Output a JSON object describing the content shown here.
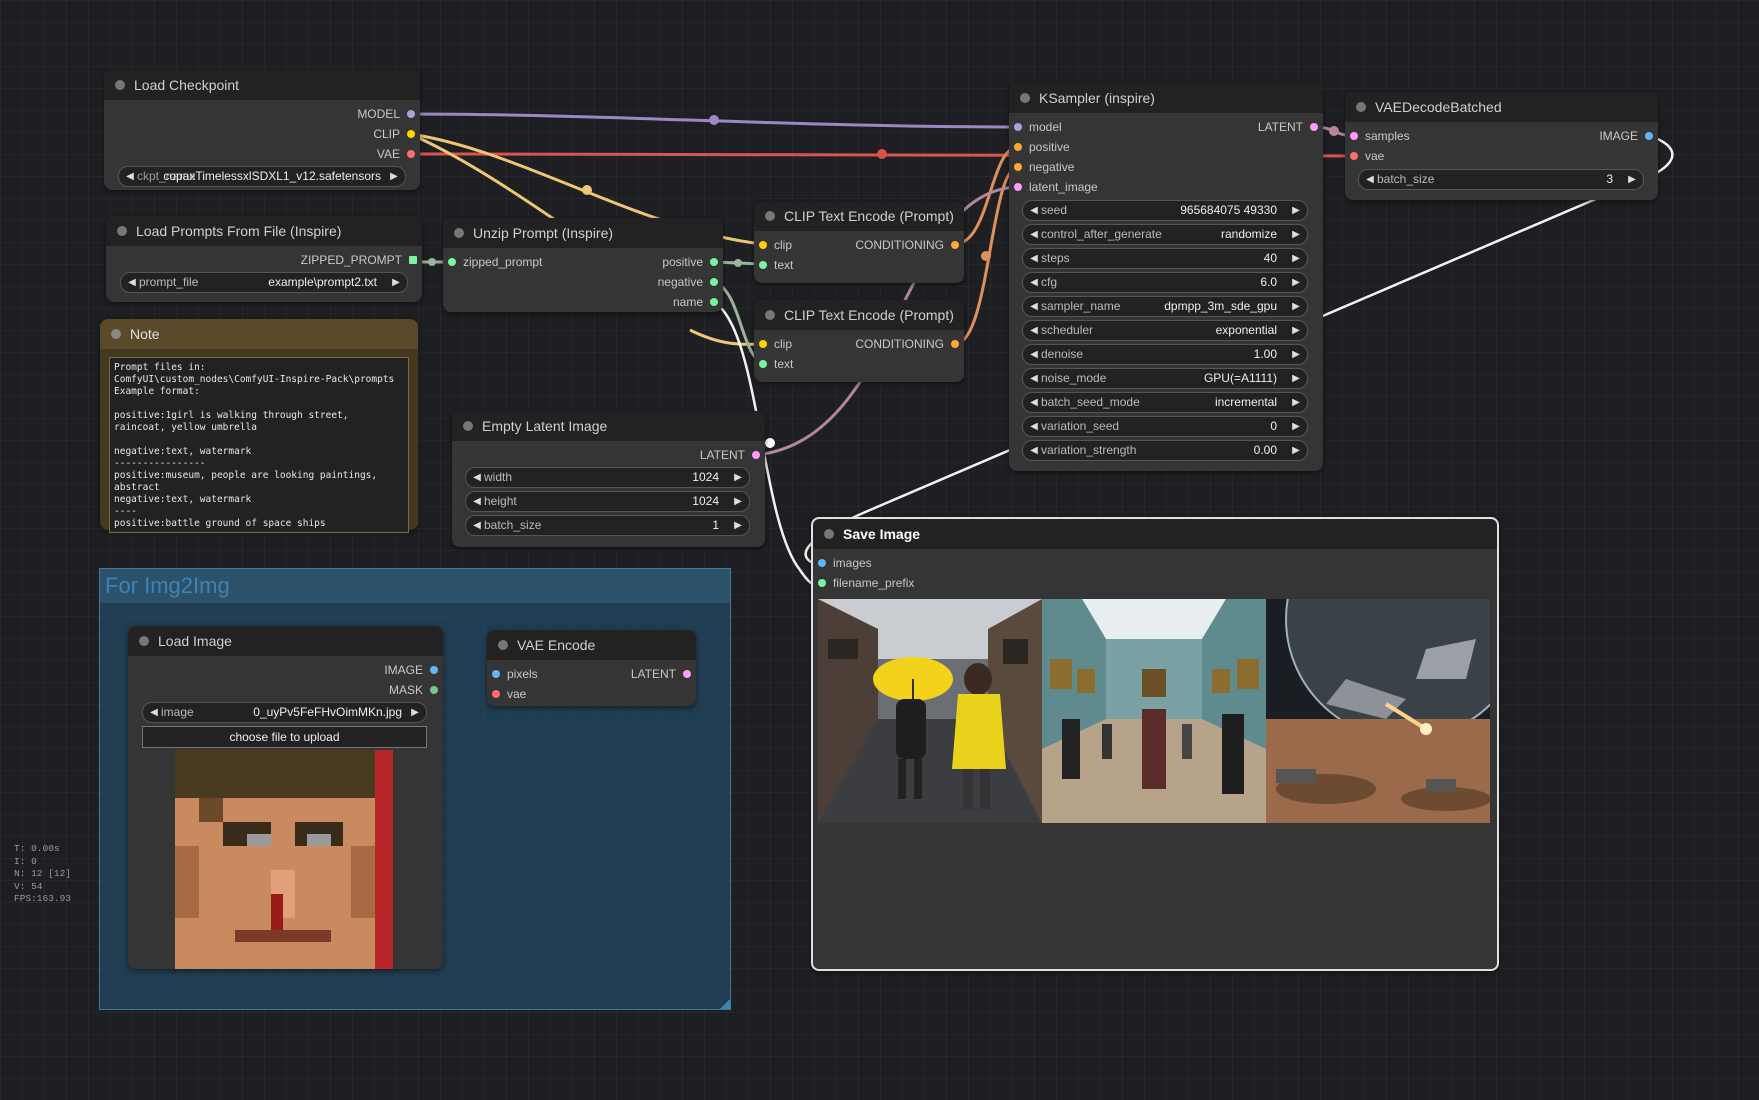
{
  "colors": {
    "model": "#b39ddb",
    "clip": "#ffd500",
    "vae": "#ff6e6e",
    "latent": "#ff9cf9",
    "conditioning": "#ffa931",
    "image": "#64b5f6",
    "string": "#7cf49d",
    "mask": "#81c784"
  },
  "group": {
    "title": "For Img2Img"
  },
  "load_checkpoint": {
    "title": "Load Checkpoint",
    "outputs": [
      "MODEL",
      "CLIP",
      "VAE"
    ],
    "ckpt_name": "ckpt_name",
    "ckpt_value": "copaxTimelessxlSDXL1_v12.safetensors"
  },
  "load_prompts": {
    "title": "Load Prompts From File (Inspire)",
    "output": "ZIPPED_PROMPT",
    "widget_label": "prompt_file",
    "widget_value": "example\\prompt2.txt"
  },
  "unzip": {
    "title": "Unzip Prompt (Inspire)",
    "input": "zipped_prompt",
    "outputs": [
      "positive",
      "negative",
      "name"
    ]
  },
  "clip1": {
    "title": "CLIP Text Encode (Prompt)",
    "inputs": [
      "clip",
      "text"
    ],
    "output": "CONDITIONING"
  },
  "clip2": {
    "title": "CLIP Text Encode (Prompt)",
    "inputs": [
      "clip",
      "text"
    ],
    "output": "CONDITIONING"
  },
  "note": {
    "title": "Note",
    "text": "Prompt files in:\nComfyUI\\custom_nodes\\ComfyUI-Inspire-Pack\\prompts\nExample format:\n\npositive:1girl is walking through street,\nraincoat, yellow umbrella\n\nnegative:text, watermark\n----------------\npositive:museum, people are looking paintings,\nabstract\nnegative:text, watermark\n----\npositive:battle ground of space ships\n\nnegative:text, watermark"
  },
  "empty_latent": {
    "title": "Empty Latent Image",
    "output": "LATENT",
    "widgets": [
      {
        "label": "width",
        "value": "1024"
      },
      {
        "label": "height",
        "value": "1024"
      },
      {
        "label": "batch_size",
        "value": "1"
      }
    ]
  },
  "ksampler": {
    "title": "KSampler (inspire)",
    "inputs": [
      "model",
      "positive",
      "negative",
      "latent_image"
    ],
    "output": "LATENT",
    "widgets": [
      {
        "label": "seed",
        "value": "965684075 49330"
      },
      {
        "label": "control_after_generate",
        "value": "randomize"
      },
      {
        "label": "steps",
        "value": "40"
      },
      {
        "label": "cfg",
        "value": "6.0"
      },
      {
        "label": "sampler_name",
        "value": "dpmpp_3m_sde_gpu"
      },
      {
        "label": "scheduler",
        "value": "exponential"
      },
      {
        "label": "denoise",
        "value": "1.00"
      },
      {
        "label": "noise_mode",
        "value": "GPU(=A1111)"
      },
      {
        "label": "batch_seed_mode",
        "value": "incremental"
      },
      {
        "label": "variation_seed",
        "value": "0"
      },
      {
        "label": "variation_strength",
        "value": "0.00"
      }
    ]
  },
  "vae_decode": {
    "title": "VAEDecodeBatched",
    "inputs": [
      "samples",
      "vae"
    ],
    "output": "IMAGE",
    "widget_label": "batch_size",
    "widget_value": "3"
  },
  "save_image": {
    "title": "Save Image",
    "inputs": [
      "images",
      "filename_prefix"
    ]
  },
  "load_image": {
    "title": "Load Image",
    "outputs": [
      "IMAGE",
      "MASK"
    ],
    "widget_label": "image",
    "widget_value": "0_uyPv5FeFHvOimMKn.jpg",
    "upload_label": "choose file to upload"
  },
  "vae_encode": {
    "title": "VAE Encode",
    "inputs": [
      "pixels",
      "vae"
    ],
    "output": "LATENT"
  },
  "stats": [
    "T: 0.00s",
    "I: 0",
    "N: 12 [12]",
    "V: 54",
    "FPS:163.93"
  ]
}
